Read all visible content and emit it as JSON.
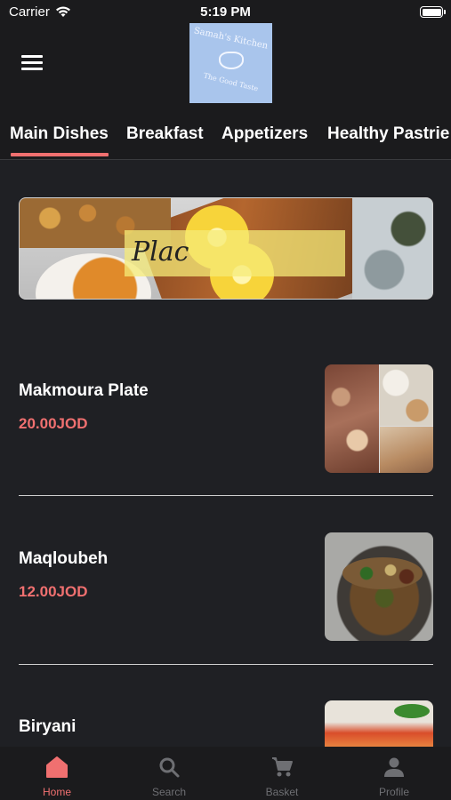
{
  "status_bar": {
    "carrier": "Carrier",
    "time": "5:19 PM"
  },
  "header": {
    "logo": {
      "name": "Samah's Kitchen",
      "tagline": "The Good Taste",
      "background": "#a9c5ec"
    }
  },
  "tabs": [
    {
      "label": "Main Dishes",
      "active": true
    },
    {
      "label": "Breakfast",
      "active": false
    },
    {
      "label": "Appetizers",
      "active": false
    },
    {
      "label": "Healthy Pastrie",
      "active": false
    }
  ],
  "banner": {
    "overlay_text": "Plac"
  },
  "items": [
    {
      "name": "Makmoura Plate",
      "price": "20.00JOD",
      "image_icon": "makmoura-photo"
    },
    {
      "name": "Maqloubeh",
      "price": "12.00JOD",
      "image_icon": "maqloubeh-photo"
    },
    {
      "name": "Biryani",
      "price": "",
      "image_icon": "biryani-photo"
    }
  ],
  "tab_bar": [
    {
      "label": "Home",
      "icon": "home-icon",
      "active": true
    },
    {
      "label": "Search",
      "icon": "search-icon",
      "active": false
    },
    {
      "label": "Basket",
      "icon": "cart-icon",
      "active": false
    },
    {
      "label": "Profile",
      "icon": "profile-icon",
      "active": false
    }
  ],
  "colors": {
    "accent": "#f07070",
    "background": "#1f2024",
    "bar": "#1b1b1d",
    "inactive": "#6e6f73"
  }
}
